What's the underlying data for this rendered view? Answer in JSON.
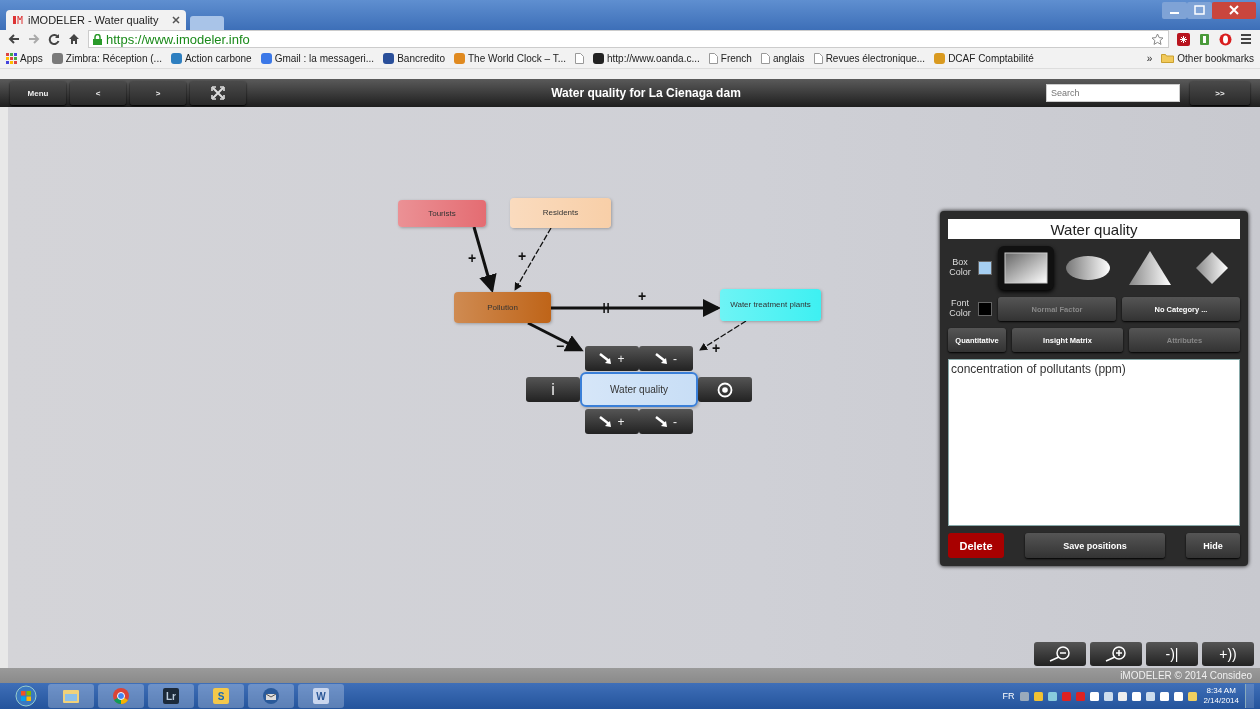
{
  "browser": {
    "tab_title": "iMODELER - Water quality",
    "address": "https://www.imodeler.info",
    "bookmarks": [
      {
        "label": "Apps",
        "kind": "apps"
      },
      {
        "label": "Zimbra: Réception (...",
        "kind": "site",
        "color": "#7a7a7a"
      },
      {
        "label": "Action carbone",
        "kind": "site",
        "color": "#2e7fc0"
      },
      {
        "label": "Gmail : la messageri...",
        "kind": "site",
        "color": "#3b78e7"
      },
      {
        "label": "Bancredito",
        "kind": "site",
        "color": "#2a4f9a"
      },
      {
        "label": "The World Clock – T...",
        "kind": "site",
        "color": "#e08a20"
      },
      {
        "kind": "page"
      },
      {
        "label": "http://www.oanda.c...",
        "kind": "site",
        "color": "#222222"
      },
      {
        "label": "French",
        "kind": "page"
      },
      {
        "label": "anglais",
        "kind": "page"
      },
      {
        "label": "Revues électronique...",
        "kind": "page"
      },
      {
        "label": "DCAF Comptabilité",
        "kind": "site",
        "color": "#d99a20"
      }
    ],
    "overflow": "»",
    "other_bookmarks": "Other bookmarks"
  },
  "toolbar": {
    "buttons": [
      {
        "kind": "text",
        "label": "Menu"
      },
      {
        "kind": "text",
        "label": "<"
      },
      {
        "kind": "text",
        "label": ">"
      },
      {
        "kind": "fit"
      }
    ],
    "title": "Water quality for La Cienaga dam",
    "search": {
      "placeholder": "Search"
    },
    "go": ">>"
  },
  "diagram": {
    "nodes": [
      {
        "label": "Tourists",
        "color": "#e46c72",
        "selected": false
      },
      {
        "label": "Residents",
        "color": "#f8cfa8",
        "selected": false
      },
      {
        "label": "Pollution",
        "color": "#bf6418",
        "selected": false
      },
      {
        "label": "Water treatment plants",
        "color": "#3ef0f2",
        "selected": false
      },
      {
        "label": "Water quality",
        "color": "#c8def6",
        "selected": true
      }
    ],
    "links": [
      {
        "sign": "+",
        "strong": true,
        "delayed": false
      },
      {
        "sign": "+",
        "strong": false,
        "delayed": false
      },
      {
        "sign": "+",
        "strong": true,
        "delayed": true
      },
      {
        "sign": "−",
        "strong": true,
        "delayed": false
      },
      {
        "sign": "+",
        "strong": false,
        "delayed": false
      }
    ],
    "selection_tools": {
      "info": "i",
      "top": [
        "+",
        "-"
      ],
      "bottom": [
        "+",
        "-"
      ]
    }
  },
  "panel": {
    "name": "Water quality",
    "box_color_label": "Box Color",
    "font_color_label": "Font Color",
    "shapes": [
      {
        "kind": "rectangle",
        "selected": true
      },
      {
        "kind": "ellipse",
        "selected": false
      },
      {
        "kind": "triangle",
        "selected": false
      },
      {
        "kind": "diamond",
        "selected": false
      }
    ],
    "buttons": [
      {
        "label": "Normal Factor",
        "disabled": true
      },
      {
        "label": "No Category ...",
        "disabled": false
      },
      {
        "label": "Quantitative",
        "disabled": false
      },
      {
        "label": "Insight Matrix",
        "disabled": false
      },
      {
        "label": "Attributes",
        "disabled": true
      }
    ],
    "description": "concentration of pollutants (ppm)",
    "actions": [
      {
        "label": "Delete",
        "kind": "danger"
      },
      {
        "label": "Save positions",
        "kind": "normal"
      },
      {
        "label": "Hide",
        "kind": "normal"
      }
    ]
  },
  "zoom_controls": [
    {
      "kind": "zoom-out"
    },
    {
      "kind": "zoom-in"
    },
    {
      "kind": "text",
      "label": "-)|"
    },
    {
      "kind": "text",
      "label": "+))"
    }
  ],
  "footer": "iMODELER © 2014 Consideo",
  "taskbar": {
    "apps": [
      {
        "kind": "start"
      },
      {
        "kind": "folder"
      },
      {
        "kind": "chrome"
      },
      {
        "kind": "letter",
        "label": "Lr",
        "color": "#1c2a3a"
      },
      {
        "kind": "letter",
        "label": "S",
        "color": "#f4c84a"
      },
      {
        "kind": "mail"
      },
      {
        "kind": "letter",
        "label": "W",
        "color": "#c9d6ee"
      }
    ],
    "language": "FR",
    "time": "8:34 AM",
    "date": "2/14/2014"
  }
}
